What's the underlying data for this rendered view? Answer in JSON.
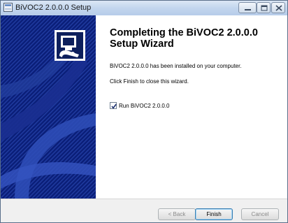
{
  "window": {
    "title": "BiVOC2 2.0.0.0 Setup",
    "controls": {
      "minimize_icon": "minimize-icon",
      "maximize_icon": "maximize-icon",
      "close_icon": "close-icon"
    }
  },
  "content": {
    "heading": "Completing the BiVOC2 2.0.0.0 Setup Wizard",
    "installed_text": "BiVOC2 2.0.0.0 has been installed on your computer.",
    "finish_text": "Click Finish to close this wizard.",
    "run_checkbox": {
      "label": "Run BiVOC2 2.0.0.0",
      "checked": true
    }
  },
  "buttons": {
    "back": "< Back",
    "finish": "Finish",
    "cancel": "Cancel"
  },
  "colors": {
    "sidebar": "#0a1e78",
    "accent": "#3c7fb1"
  }
}
